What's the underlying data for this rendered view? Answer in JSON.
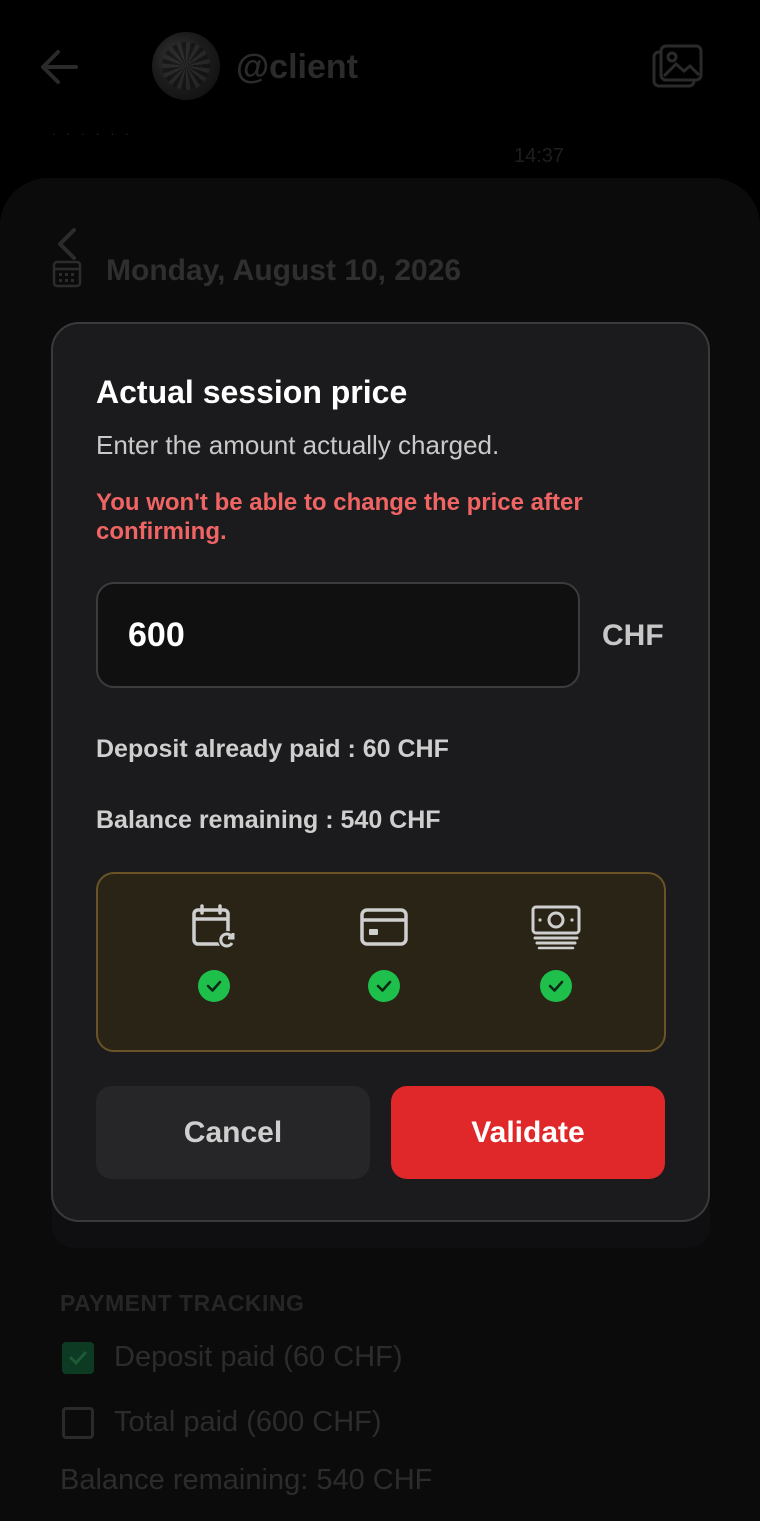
{
  "header": {
    "username": "@client",
    "message_preview": ". . . . . .",
    "message_time": "14:37"
  },
  "session": {
    "date_title": "Monday, August 10, 2026"
  },
  "dialog": {
    "title": "Actual session price",
    "subtitle": "Enter the amount actually charged.",
    "warning": "You won't be able to change the price after confirming.",
    "price_value": "600",
    "currency": "CHF",
    "deposit_text": "Deposit already paid : 60 CHF",
    "balance_text": "Balance remaining : 540 CHF",
    "status_icons": [
      {
        "icon": "calendar-refresh-icon",
        "done": true
      },
      {
        "icon": "credit-card-icon",
        "done": true
      },
      {
        "icon": "cash-stack-icon",
        "done": true
      }
    ],
    "cancel_label": "Cancel",
    "validate_label": "Validate"
  },
  "payment_tracking": {
    "section_title": "PAYMENT TRACKING",
    "items": [
      {
        "label": "Deposit paid (60 CHF)",
        "checked": true
      },
      {
        "label": "Total paid (600 CHF)",
        "checked": false
      }
    ],
    "balance_text": "Balance remaining: 540 CHF"
  },
  "colors": {
    "accent_red": "#e0282a",
    "warning_text": "#f06464",
    "success_green": "#1fbf4b",
    "status_border": "#6a5326"
  }
}
